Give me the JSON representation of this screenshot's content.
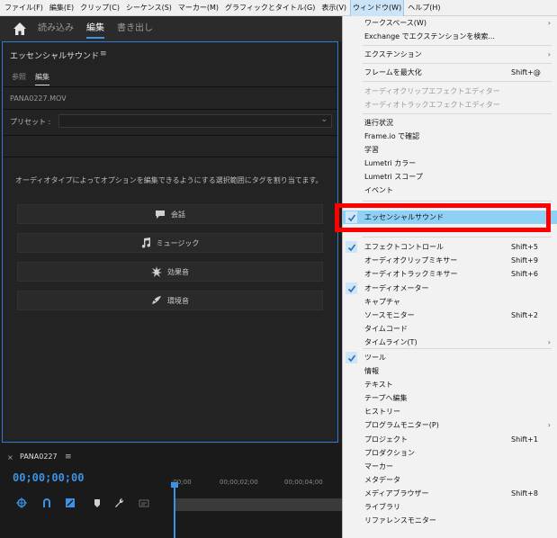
{
  "menubar": {
    "items": [
      "ファイル(F)",
      "編集(E)",
      "クリップ(C)",
      "シーケンス(S)",
      "マーカー(M)",
      "グラフィックとタイトル(G)",
      "表示(V)",
      "ウィンドウ(W)",
      "ヘルプ(H)"
    ]
  },
  "header": {
    "tabs": [
      "読み込み",
      "編集",
      "書き出し"
    ]
  },
  "panel": {
    "title": "エッセンシャルサウンド",
    "menu_glyph": "≡",
    "tabs": [
      "参照",
      "編集"
    ],
    "clip_name": "PANA0227.MOV",
    "preset_label": "プリセット :",
    "preset_value": "",
    "instructions": "オーディオタイプによってオプションを編集できるようにする選択範囲にタグを割り当てます。",
    "types": [
      "会話",
      "ミュージック",
      "効果音",
      "環境音"
    ]
  },
  "sequence": {
    "close_glyph": "×",
    "name": "PANA0227",
    "menu_glyph": "≡",
    "timecode": "00;00;00;00",
    "ruler": [
      ";00;00",
      "00;00;02;00",
      "00;00;04;00"
    ]
  },
  "window_menu": {
    "items": [
      {
        "label": "ワークスペース(W)",
        "submenu": true
      },
      {
        "label": "Exchange でエクステンションを検索..."
      },
      {
        "label": "エクステンション",
        "submenu": true
      },
      {
        "label": "フレームを最大化",
        "shortcut": "Shift+@"
      },
      {
        "label": "オーディオクリップエフェクトエディター",
        "disabled": true
      },
      {
        "label": "オーディオトラックエフェクトエディター",
        "disabled": true
      },
      {
        "label": "進行状況"
      },
      {
        "label": "Frame.io で確認"
      },
      {
        "label": "学習"
      },
      {
        "label": "Lumetri カラー"
      },
      {
        "label": "Lumetri スコープ"
      },
      {
        "label": "イベント"
      },
      {
        "label": "エッセンシャルサウンド",
        "checked": true
      },
      {
        "label": "エフェクトコントロール",
        "checked": true,
        "shortcut": "Shift+5"
      },
      {
        "label": "オーディオクリップミキサー",
        "shortcut": "Shift+9"
      },
      {
        "label": "オーディオトラックミキサー",
        "shortcut": "Shift+6"
      },
      {
        "label": "オーディオメーター",
        "checked": true
      },
      {
        "label": "キャプチャ"
      },
      {
        "label": "ソースモニター",
        "shortcut": "Shift+2"
      },
      {
        "label": "タイムコード"
      },
      {
        "label": "タイムライン(T)",
        "submenu": true
      },
      {
        "label": "ツール",
        "checked": true
      },
      {
        "label": "情報"
      },
      {
        "label": "テキスト"
      },
      {
        "label": "テープへ編集"
      },
      {
        "label": "ヒストリー"
      },
      {
        "label": "プログラムモニター(P)",
        "submenu": true
      },
      {
        "label": "プロジェクト",
        "shortcut": "Shift+1"
      },
      {
        "label": "プロダクション"
      },
      {
        "label": "マーカー"
      },
      {
        "label": "メタデータ"
      },
      {
        "label": "メディアブラウザー",
        "shortcut": "Shift+8"
      },
      {
        "label": "ライブラリ"
      },
      {
        "label": "リファレンスモニター"
      }
    ],
    "submenu_glyph": "›"
  },
  "colors": {
    "accent_blue": "#3c92e6",
    "highlight_row": "#8fd0f7",
    "annotation_red": "#ff0000"
  }
}
